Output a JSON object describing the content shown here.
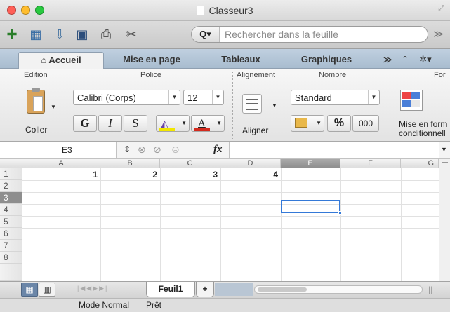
{
  "window": {
    "title": "Classeur3"
  },
  "toolbar": {
    "search_placeholder": "Rechercher dans la feuille",
    "search_prefix": "Q▾",
    "overflow": "≫"
  },
  "tabs": [
    {
      "label": "Accueil",
      "icon": "home-icon"
    },
    {
      "label": "Mise en page"
    },
    {
      "label": "Tableaux"
    },
    {
      "label": "Graphiques"
    }
  ],
  "tab_overflow": "≫",
  "ribbon": {
    "groups": {
      "edition": "Edition",
      "police": "Police",
      "alignement": "Alignement",
      "nombre": "Nombre",
      "format": "For"
    },
    "paste_label": "Coller",
    "font_name": "Calibri (Corps)",
    "font_size": "12",
    "bold": "G",
    "italic": "I",
    "underline": "S",
    "font_color_letter": "A",
    "align_label": "Aligner",
    "number_format": "Standard",
    "percent": "%",
    "thousands": "000",
    "conditional_format_line1": "Mise en form",
    "conditional_format_line2": "conditionnell",
    "colors": {
      "highlight": "#f2e700",
      "font_color": "#d32b1e",
      "selection": "#3479d8"
    }
  },
  "formula_bar": {
    "cell_ref": "E3",
    "fx": "fx",
    "value": ""
  },
  "sheet": {
    "columns": [
      "A",
      "B",
      "C",
      "D",
      "E",
      "F",
      "G"
    ],
    "rows": [
      "1",
      "2",
      "3",
      "4",
      "5",
      "6",
      "7",
      "8"
    ],
    "cells": {
      "A1": "1",
      "B1": "2",
      "C1": "3",
      "D1": "4"
    },
    "selected_cell": "E3"
  },
  "sheet_tabs": [
    {
      "label": "Feuil1"
    }
  ],
  "add_sheet": "+",
  "status": {
    "view_mode": "Mode Normal",
    "ready": "Prêt"
  }
}
